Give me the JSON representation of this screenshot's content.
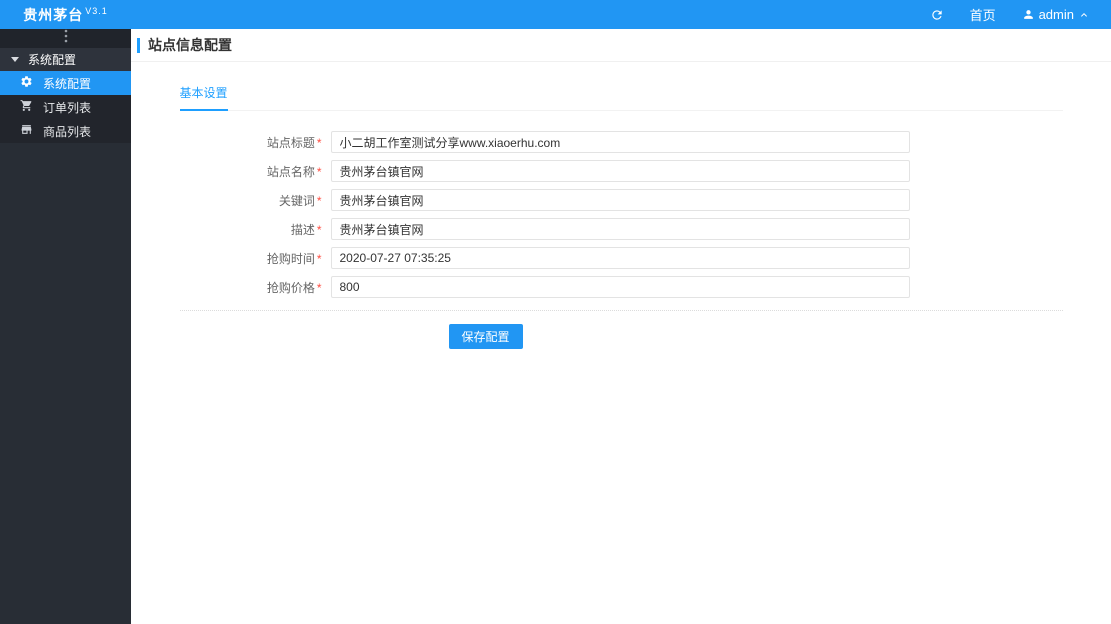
{
  "topbar": {
    "brand": "贵州茅台",
    "version": "V3.1",
    "home_label": "首页",
    "username": "admin"
  },
  "sidebar": {
    "group_label": "系统配置",
    "items": [
      {
        "label": "系统配置",
        "icon": "gear-icon",
        "active": true
      },
      {
        "label": "订单列表",
        "icon": "cart-icon",
        "active": false
      },
      {
        "label": "商品列表",
        "icon": "store-icon",
        "active": false
      }
    ]
  },
  "page": {
    "title": "站点信息配置",
    "tab_label": "基本设置"
  },
  "form": {
    "fields": [
      {
        "label": "站点标题",
        "required": true,
        "value": "小二胡工作室测试分享www.xiaoerhu.com"
      },
      {
        "label": "站点名称",
        "required": true,
        "value": "贵州茅台镇官网"
      },
      {
        "label": "关键词",
        "required": true,
        "value": "贵州茅台镇官网"
      },
      {
        "label": "描述",
        "required": true,
        "value": "贵州茅台镇官网"
      },
      {
        "label": "抢购时间",
        "required": true,
        "value": "2020-07-27 07:35:25"
      },
      {
        "label": "抢购价格",
        "required": true,
        "value": "800"
      }
    ],
    "submit_label": "保存配置"
  },
  "colors": {
    "primary": "#2196f3",
    "accent": "#1e9fff",
    "sidebar_bg": "#282d35",
    "required": "#ff4d42"
  }
}
